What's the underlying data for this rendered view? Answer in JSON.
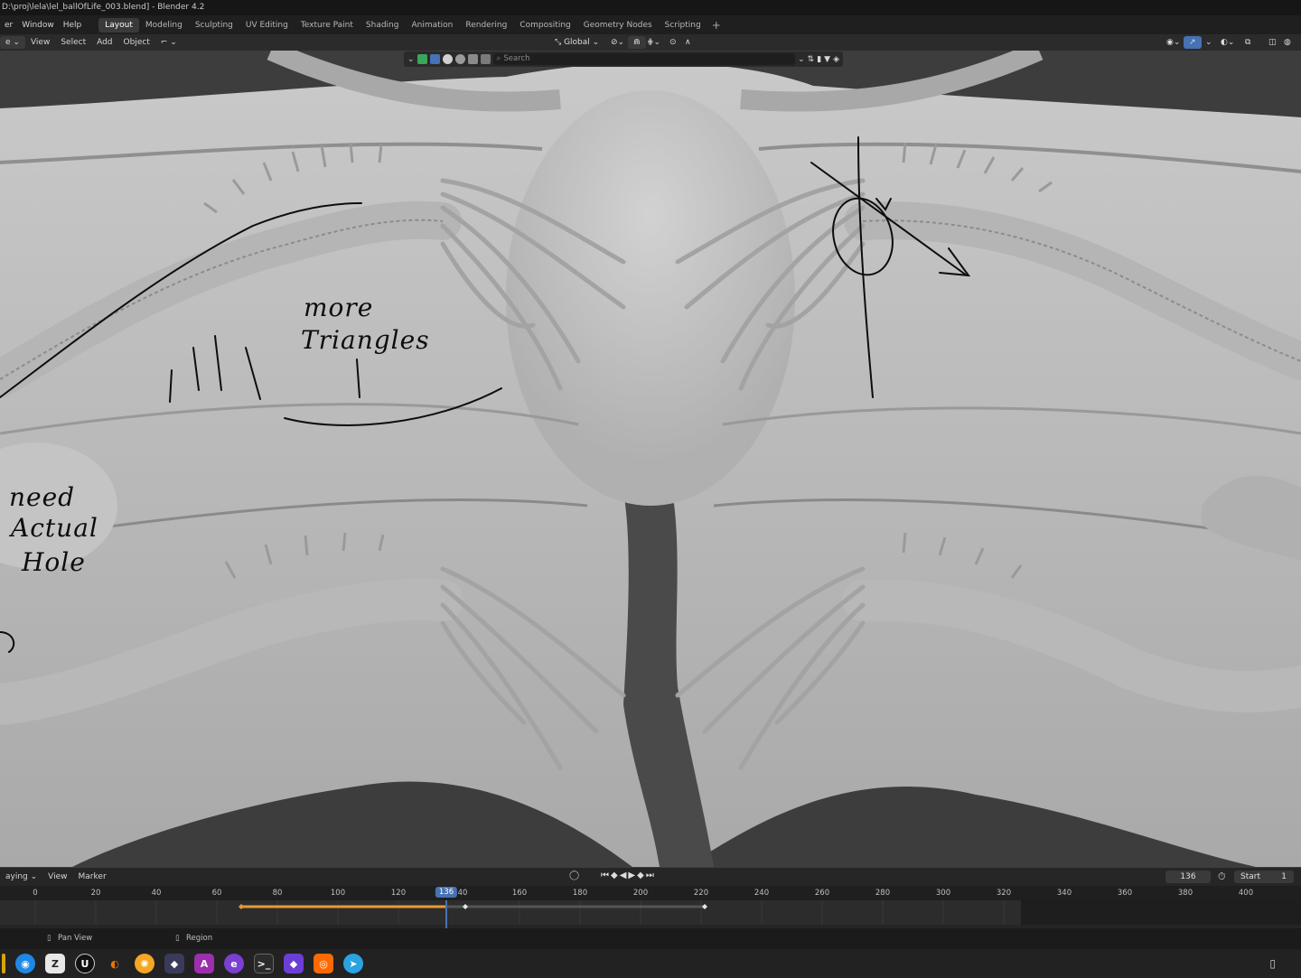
{
  "window": {
    "title": "D:\\proj\\lela\\lel_ballOfLife_003.blend] - Blender 4.2"
  },
  "menubar": {
    "menus": [
      "er",
      "Window",
      "Help"
    ],
    "workspaces": [
      "Layout",
      "Modeling",
      "Sculpting",
      "UV Editing",
      "Texture Paint",
      "Shading",
      "Animation",
      "Rendering",
      "Compositing",
      "Geometry Nodes",
      "Scripting"
    ],
    "active_workspace": "Layout",
    "add_label": "+"
  },
  "viewport_header": {
    "mode_label": "e",
    "menus": [
      "View",
      "Select",
      "Add",
      "Object"
    ],
    "transform_orientation": "Global"
  },
  "outliner_filter": {
    "search_placeholder": "Search"
  },
  "annotations": {
    "note1_line1": "more",
    "note1_line2": "Triangles",
    "note2_line1": "need",
    "note2_line2": "Actual",
    "note2_line3": "Hole"
  },
  "timeline": {
    "playback_label": "aying",
    "menus": [
      "View",
      "Marker"
    ],
    "current_frame": "136",
    "start_label": "Start",
    "start_value": "1",
    "ruler_ticks": [
      "0",
      "20",
      "40",
      "60",
      "80",
      "100",
      "120",
      "",
      "160",
      "180",
      "200",
      "220",
      "240",
      "260",
      "280",
      "300",
      "320",
      "340",
      "360",
      "380",
      "400"
    ],
    "ruler_partial": "40",
    "playhead_label": "136"
  },
  "statusbar": {
    "pan_view": "Pan View",
    "region": "Region"
  },
  "colors": {
    "accent_blue": "#4772b3",
    "key_orange": "#e89b33",
    "viewport_bg": "#3d3d3d",
    "mesh_gray": "#b7b7b7"
  }
}
